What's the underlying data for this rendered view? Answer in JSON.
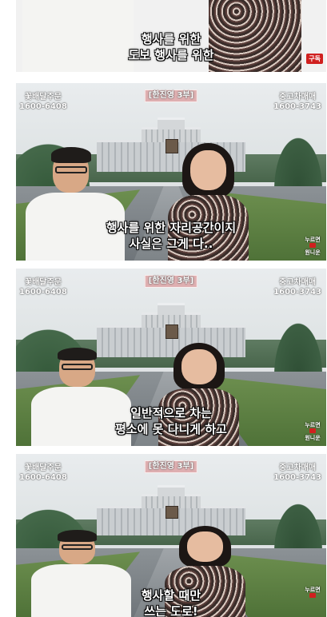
{
  "overlay": {
    "left_text": "꽃배달주문",
    "left_phone": "1600-6408",
    "right_text": "중고차매매",
    "right_phone": "1600-3743",
    "center_tag": "[한진영 3부]"
  },
  "frames": [
    {
      "subtitle_1": "행사를 위한",
      "subtitle_2": "도보 행사를 위한",
      "badge": "구독"
    },
    {
      "subtitle_1": "행사를 위한 자리공간이지",
      "subtitle_2": "사실은 그게 다..",
      "logo_1": "누르면",
      "logo_2": "원니운"
    },
    {
      "subtitle_1": "일반적으로 차는",
      "subtitle_2": "평소에 못 다니게 하고",
      "logo_1": "누르면",
      "logo_2": "원니운"
    },
    {
      "subtitle_1": "행사할 때만",
      "subtitle_2": "쓰는 도로!",
      "logo_1": "누르면",
      "logo_2": ""
    }
  ]
}
